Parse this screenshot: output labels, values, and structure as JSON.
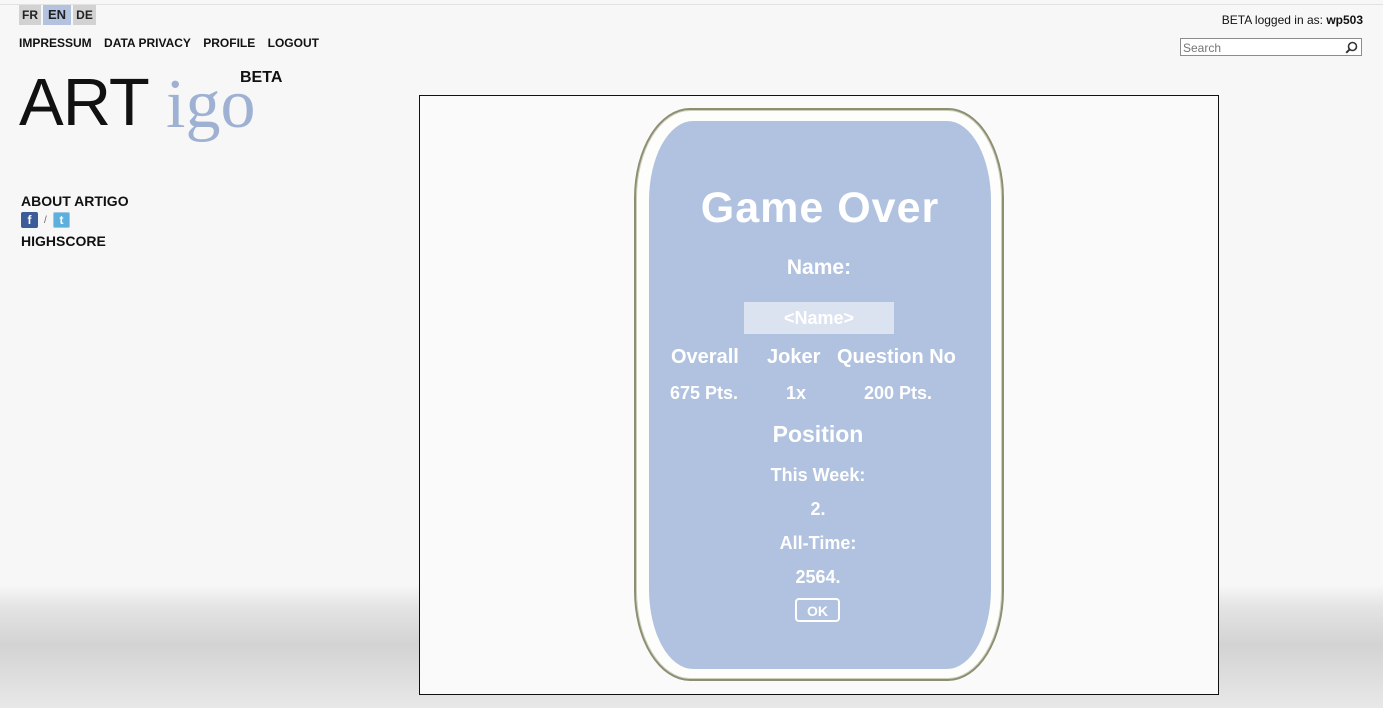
{
  "languages": [
    {
      "code": "FR",
      "active": false
    },
    {
      "code": "EN",
      "active": true
    },
    {
      "code": "DE",
      "active": false
    }
  ],
  "topnav": {
    "impressum": "IMPRESSUM",
    "data_privacy": "DATA PRIVACY",
    "profile": "PROFILE",
    "logout": "LOGOUT"
  },
  "logo": {
    "art": "ART",
    "igo": "igo",
    "badge": "BETA"
  },
  "sidebar": {
    "about": "ABOUT ARTIGO",
    "facebook_glyph": "f",
    "slash": "/",
    "twitter_glyph": "t",
    "highscore": "HIGHSCORE"
  },
  "user": {
    "prefix": "BETA logged in as: ",
    "username": "wp503"
  },
  "search": {
    "placeholder": "Search",
    "value": ""
  },
  "game_over": {
    "title": "Game Over",
    "name_label": "Name:",
    "name_placeholder": "<Name>",
    "col_overall": "Overall",
    "col_joker": "Joker",
    "col_question_no": "Question No",
    "overall_value": "675 Pts.",
    "joker_value": "1x",
    "question_value": "200 Pts.",
    "position_label": "Position",
    "this_week_label": "This Week:",
    "this_week_value": "2.",
    "all_time_label": "All-Time:",
    "all_time_value": "2564.",
    "ok_label": "OK"
  },
  "colors": {
    "card_blue": "#b0c2df",
    "logo_igo": "#9fb1d3",
    "lang_active": "#b3c3df",
    "lang_inactive": "#d2d2d2"
  }
}
